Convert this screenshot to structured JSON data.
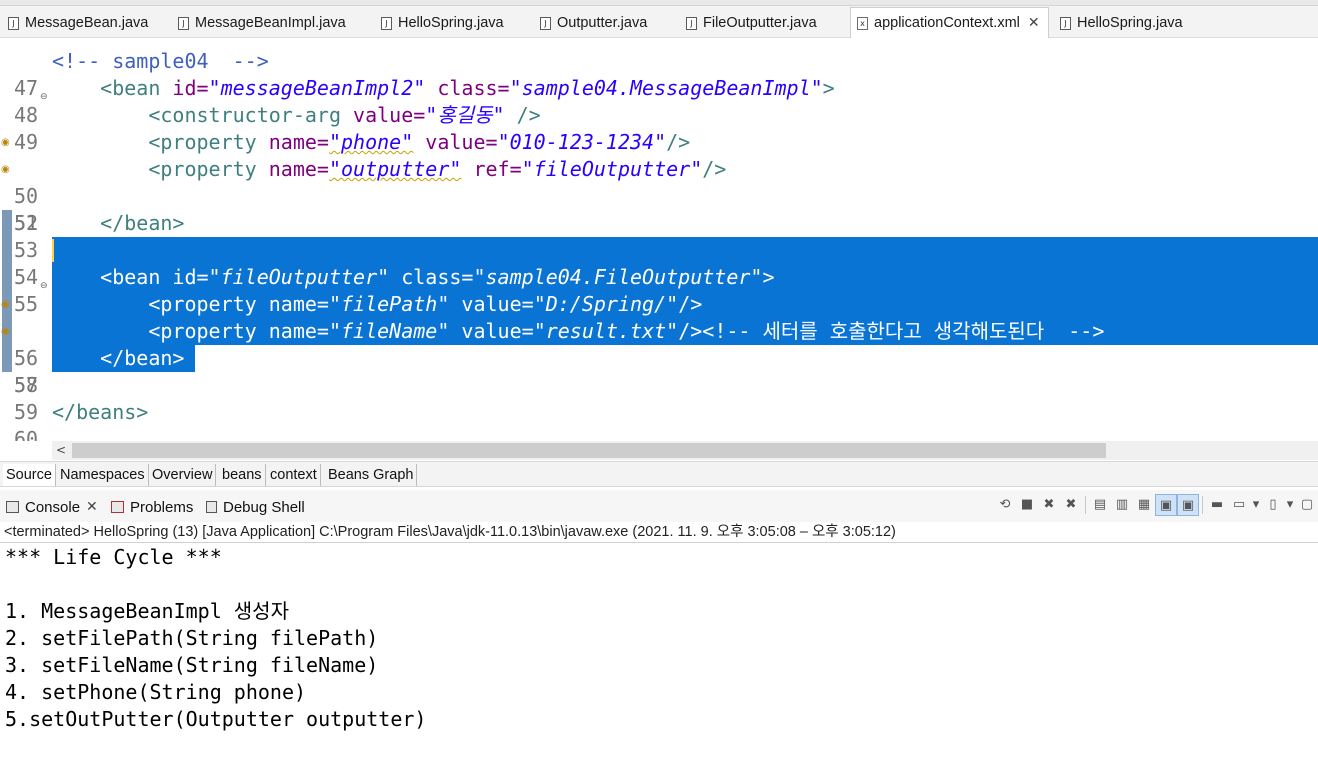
{
  "tabs": [
    {
      "label": "MessageBean.java",
      "icon": "java-file-icon"
    },
    {
      "label": "MessageBeanImpl.java",
      "icon": "java-file-icon"
    },
    {
      "label": "HelloSpring.java",
      "icon": "java-file-icon"
    },
    {
      "label": "Outputter.java",
      "icon": "java-file-icon"
    },
    {
      "label": "FileOutputter.java",
      "icon": "java-file-icon"
    },
    {
      "label": "applicationContext.xml",
      "icon": "xml-file-icon",
      "active": true
    },
    {
      "label": "HelloSpring.java",
      "icon": "java-file-icon"
    }
  ],
  "editor": {
    "line_numbers": [
      "47",
      "48",
      "49",
      "50",
      "51",
      "52",
      "53",
      "54",
      "55",
      "56",
      "57",
      "58",
      "59",
      "60"
    ],
    "lines": {
      "l47_comment": "<!-- sample04  -->",
      "l48_open": "<bean ",
      "l48_id_attr": "id=",
      "l48_id_val": "\"messageBeanImpl2\"",
      "l48_class_attr": " class=",
      "l48_class_val": "\"sample04.MessageBeanImpl\"",
      "l48_close": ">",
      "l49_open": "<constructor-arg ",
      "l49_value_attr": "value=",
      "l49_value_val": "\"홍길동\"",
      "l49_close": " />",
      "l50_open": "<property ",
      "l50_name_attr": "name=",
      "l50_name_val": "\"phone\"",
      "l50_value_attr": " value=",
      "l50_value_val": "\"010-123-1234\"",
      "l50_close": "/>",
      "l51_open": "<property ",
      "l51_name_attr": "name=",
      "l51_name_val": "\"outputter\"",
      "l51_ref_attr": " ref=",
      "l51_ref_val": "\"fileOutputter\"",
      "l51_close": "/>",
      "l53_close": "</bean>",
      "l55_open": "<bean ",
      "l55_id_attr": "id=",
      "l55_id_val": "\"fileOutputter\"",
      "l55_class_attr": " class=",
      "l55_class_val": "\"sample04.FileOutputter\"",
      "l55_close": ">",
      "l56_open": "<property ",
      "l56_name_attr": "name=",
      "l56_name_val": "\"filePath\"",
      "l56_value_attr": " value=",
      "l56_value_val": "\"D:/Spring/\"",
      "l56_close": "/>",
      "l57_open": "<property ",
      "l57_name_attr": "name=",
      "l57_name_val": "\"fileName\"",
      "l57_value_attr": " value=",
      "l57_value_val": "\"result.txt\"",
      "l57_close": "/>",
      "l57_comment": "<!-- 세터를 호출한다고 생각해도된다  -->",
      "l58_close": "</bean>",
      "l60_close": "</beans>"
    }
  },
  "editor_tabs": [
    "Source",
    "Namespaces",
    "Overview",
    "beans",
    "context",
    "Beans Graph"
  ],
  "view_tabs": {
    "console": "Console",
    "problems": "Problems",
    "debug_shell": "Debug Shell"
  },
  "console": {
    "status": "<terminated> HelloSpring (13) [Java Application] C:\\Program Files\\Java\\jdk-11.0.13\\bin\\javaw.exe  (2021. 11. 9. 오후 3:05:08 – 오후 3:05:12)",
    "lines": [
      "*** Life Cycle ***",
      "",
      "1. MessageBeanImpl 생성자",
      "2. setFilePath(String filePath)",
      "3. setFileName(String fileName)",
      "4. setPhone(String phone)",
      "5.setOutPutter(Outputter outputter)"
    ]
  },
  "colors": {
    "selection": "#0a74d4",
    "comment": "#3f5fbf",
    "tag": "#3f7f7f",
    "attribute": "#7f007f",
    "value": "#2a00ff"
  }
}
